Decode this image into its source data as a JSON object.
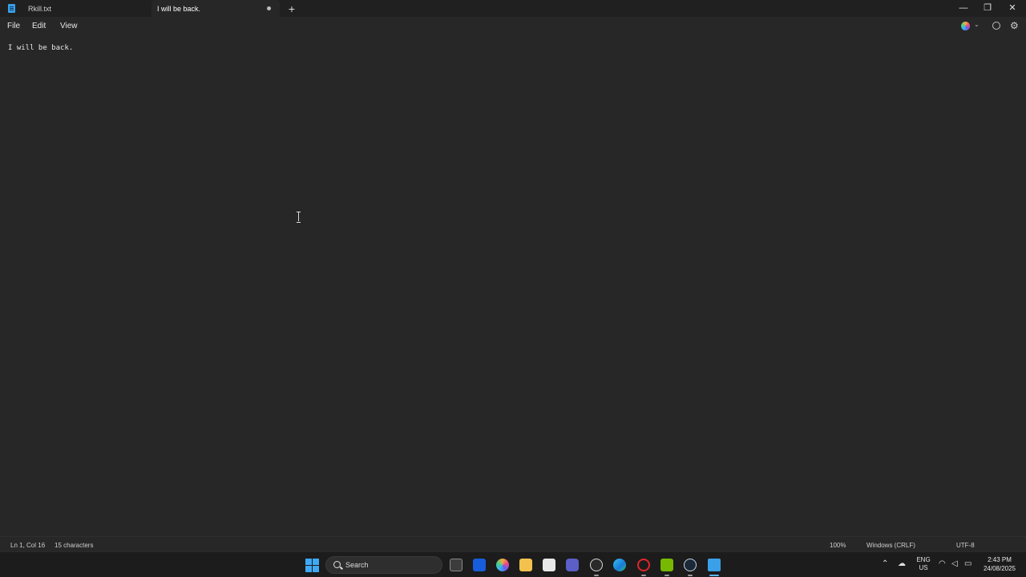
{
  "window": {
    "tabs": [
      {
        "label": "Rkill.txt",
        "active": false
      },
      {
        "label": "I will be back.",
        "active": true,
        "unsaved": true
      }
    ],
    "new_tab_symbol": "+",
    "controls": {
      "minimize": "—",
      "maximize": "❐",
      "close": "✕"
    }
  },
  "menu": {
    "items": [
      "File",
      "Edit",
      "View"
    ],
    "right_icons": [
      "copilot-icon",
      "chevron-down-icon",
      "account-icon",
      "gear-icon"
    ]
  },
  "editor": {
    "content": "I will be back."
  },
  "status": {
    "position": "Ln 1, Col 16",
    "characters": "15 characters",
    "zoom": "100%",
    "line_ending": "Windows (CRLF)",
    "encoding": "UTF-8"
  },
  "taskbar": {
    "search_placeholder": "Search",
    "apps": [
      "task-view-icon",
      "bitwarden-icon",
      "copilot-icon",
      "file-explorer-icon",
      "microsoft-store-icon",
      "teams-icon",
      "chatgpt-icon",
      "edge-icon",
      "opera-icon",
      "nvidia-icon",
      "steam-icon",
      "notepad-icon"
    ],
    "tray": {
      "lang_primary": "ENG",
      "lang_secondary": "US",
      "time": "2:43 PM",
      "date": "24/08/2025"
    }
  },
  "colors": {
    "accent": "#3aa0e8",
    "background": "#272727",
    "titlebar": "#202020",
    "taskbar": "#1c1c1c"
  }
}
